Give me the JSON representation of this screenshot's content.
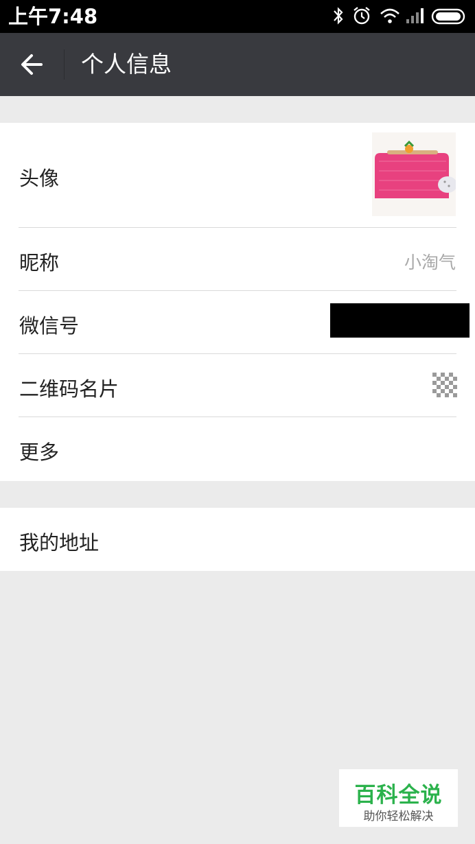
{
  "status_bar": {
    "time": "上午7:48",
    "icons": [
      "bluetooth-icon",
      "alarm-icon",
      "wifi-icon",
      "signal-icon",
      "battery-icon"
    ]
  },
  "header": {
    "title": "个人信息",
    "back_icon": "back-arrow-icon"
  },
  "profile": {
    "avatar_label": "头像",
    "nickname_label": "昵称",
    "nickname_value": "小淘气",
    "wechat_id_label": "微信号",
    "qr_label": "二维码名片",
    "more_label": "更多"
  },
  "address": {
    "label": "我的地址"
  },
  "watermark": {
    "title": "百科全说",
    "subtitle": "助你轻松解决"
  },
  "colors": {
    "header_bg": "#393a3f",
    "page_bg": "#ebebeb",
    "watermark_green": "#2bb24c"
  }
}
